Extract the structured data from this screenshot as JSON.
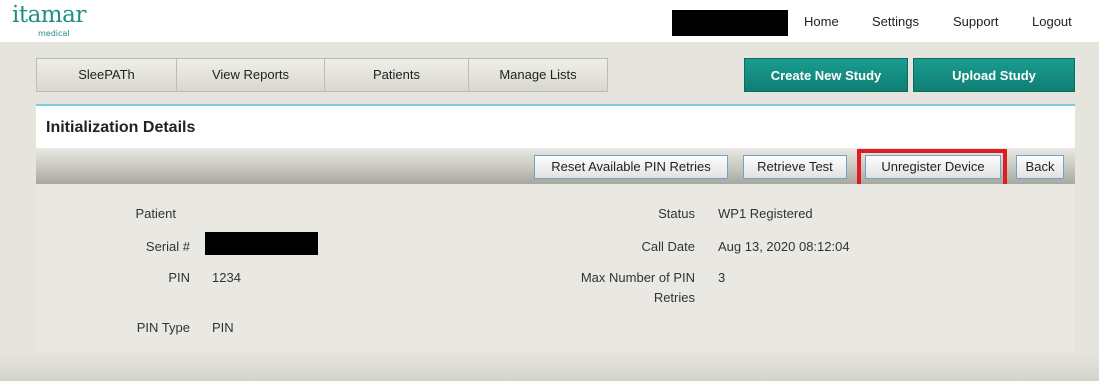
{
  "header": {
    "logo_main": "itamar",
    "logo_sub": "medical",
    "links": {
      "home": "Home",
      "settings": "Settings",
      "support": "Support",
      "logout": "Logout"
    }
  },
  "nav": {
    "tabs": [
      "SleePATh",
      "View Reports",
      "Patients",
      "Manage Lists"
    ]
  },
  "actions": {
    "create": "Create New Study",
    "upload": "Upload Study"
  },
  "panel": {
    "title": "Initialization Details",
    "toolbar": {
      "reset": "Reset Available PIN Retries",
      "retrieve": "Retrieve Test",
      "unregister": "Unregister Device",
      "back": "Back"
    }
  },
  "details": {
    "patient_label": "Patient",
    "patient_value": "",
    "serial_label": "Serial #",
    "pin_label": "PIN",
    "pin_value": "1234",
    "pin_type_label": "PIN Type",
    "pin_type_value": "PIN",
    "status_label": "Status",
    "status_value": "WP1 Registered",
    "call_date_label": "Call Date",
    "call_date_value": "Aug 13, 2020 08:12:04",
    "max_pin_label_line1": "Max Number of PIN",
    "max_pin_label_line2": "Retries",
    "max_pin_value": "3"
  },
  "colors": {
    "brand_teal": "#1f8f86",
    "button_teal": "#118578",
    "highlight_red": "#e01b24",
    "frame_grey": "#e5e4dd"
  }
}
